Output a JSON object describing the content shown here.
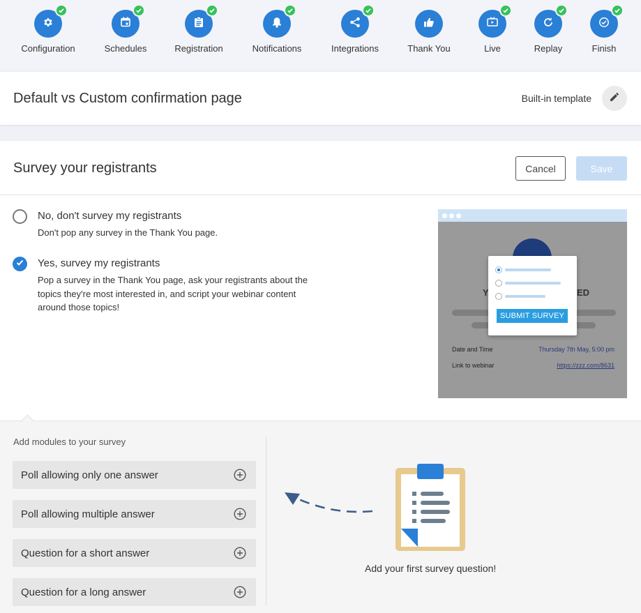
{
  "steps": [
    {
      "label": "Configuration",
      "icon": "gear-icon"
    },
    {
      "label": "Schedules",
      "icon": "calendar-icon"
    },
    {
      "label": "Registration",
      "icon": "clipboard-icon"
    },
    {
      "label": "Notifications",
      "icon": "bell-icon"
    },
    {
      "label": "Integrations",
      "icon": "share-icon"
    },
    {
      "label": "Thank You",
      "icon": "thumbs-up-icon"
    },
    {
      "label": "Live",
      "icon": "tv-icon"
    },
    {
      "label": "Replay",
      "icon": "replay-icon"
    },
    {
      "label": "Finish",
      "icon": "check-circle-icon"
    }
  ],
  "confirmation": {
    "title": "Default vs Custom confirmation page",
    "template_label": "Built-in template"
  },
  "survey": {
    "title": "Survey your registrants",
    "cancel_label": "Cancel",
    "save_label": "Save",
    "options": [
      {
        "title": "No, don't survey my registrants",
        "desc": "Don't pop any survey in the Thank You page.",
        "selected": false
      },
      {
        "title": "Yes, survey my registrants",
        "desc": "Pop a survey in the Thank You page, ask your registrants about the topics they're most interested in, and script your webinar content around those topics!",
        "selected": true
      }
    ],
    "preview": {
      "heading_left": "Y",
      "heading_right": "ED",
      "submit_label": "SUBMIT SURVEY",
      "date_label": "Date and Time",
      "date_value": "Thursday 7th May, 5:00 pm",
      "link_label": "Link to webinar",
      "link_value": "https://zzz.com/8631"
    }
  },
  "modules": {
    "title": "Add modules to your survey",
    "items": [
      {
        "label": "Poll allowing only one answer"
      },
      {
        "label": "Poll allowing multiple answer"
      },
      {
        "label": "Question for a short answer"
      },
      {
        "label": "Question for a long answer"
      }
    ],
    "empty_message": "Add your first survey question!"
  },
  "colors": {
    "accent": "#2a7fd6",
    "success": "#37c25a",
    "save_disabled": "#c5dcf4"
  }
}
